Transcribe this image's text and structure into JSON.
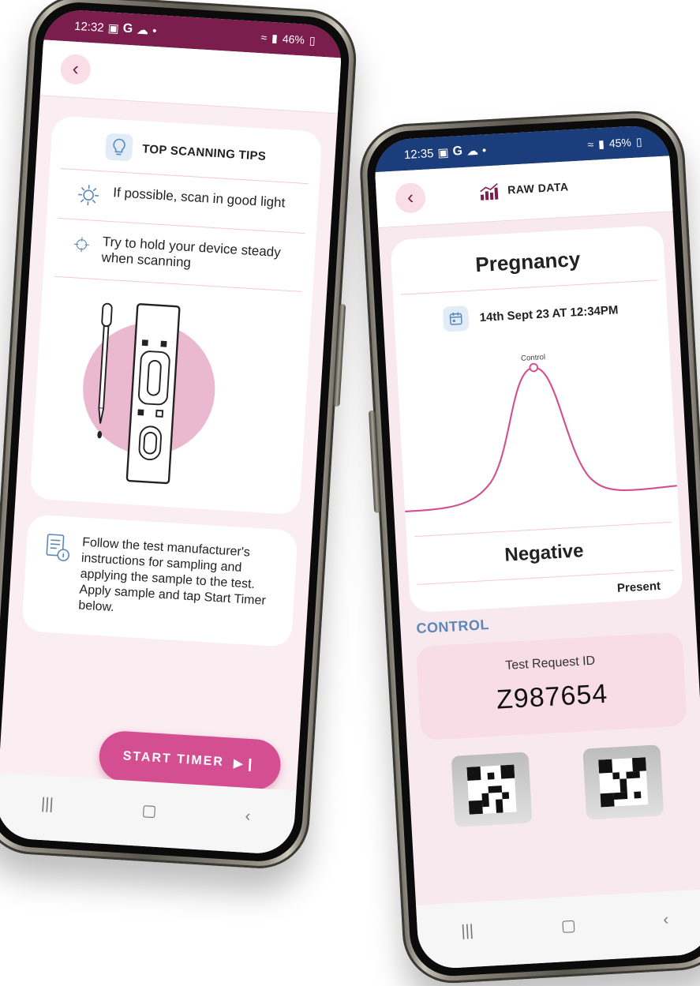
{
  "left_phone": {
    "status": {
      "time": "12:32",
      "carrier_badge": "G",
      "battery": "46%"
    },
    "tips": {
      "heading": "TOP SCANNING TIPS",
      "items": [
        {
          "icon": "gear-icon",
          "text": "If possible, scan in good light"
        },
        {
          "icon": "crosshair-icon",
          "text": "Try to hold your device steady when scanning"
        }
      ]
    },
    "instructions": "Follow the test manufacturer's instructions for sampling and applying the sample to the test. Apply sample and tap Start Timer below.",
    "start_timer_label": "START TIMER"
  },
  "right_phone": {
    "status": {
      "time": "12:35",
      "carrier_badge": "G",
      "battery": "45%"
    },
    "header_title": "RAW DATA",
    "test_name": "Pregnancy",
    "date": "14th Sept 23 AT 12:34PM",
    "peak_label": "Control",
    "result": "Negative",
    "present_label": "Present",
    "control_label": "CONTROL",
    "request_label": "Test Request ID",
    "request_id": "Z987654"
  },
  "colors": {
    "brand_plum": "#7b1d4d",
    "accent_pink": "#d44f91",
    "status_blue": "#1c3d7c",
    "card_pink": "#f8dde6",
    "control_blue": "#5b88b8"
  }
}
